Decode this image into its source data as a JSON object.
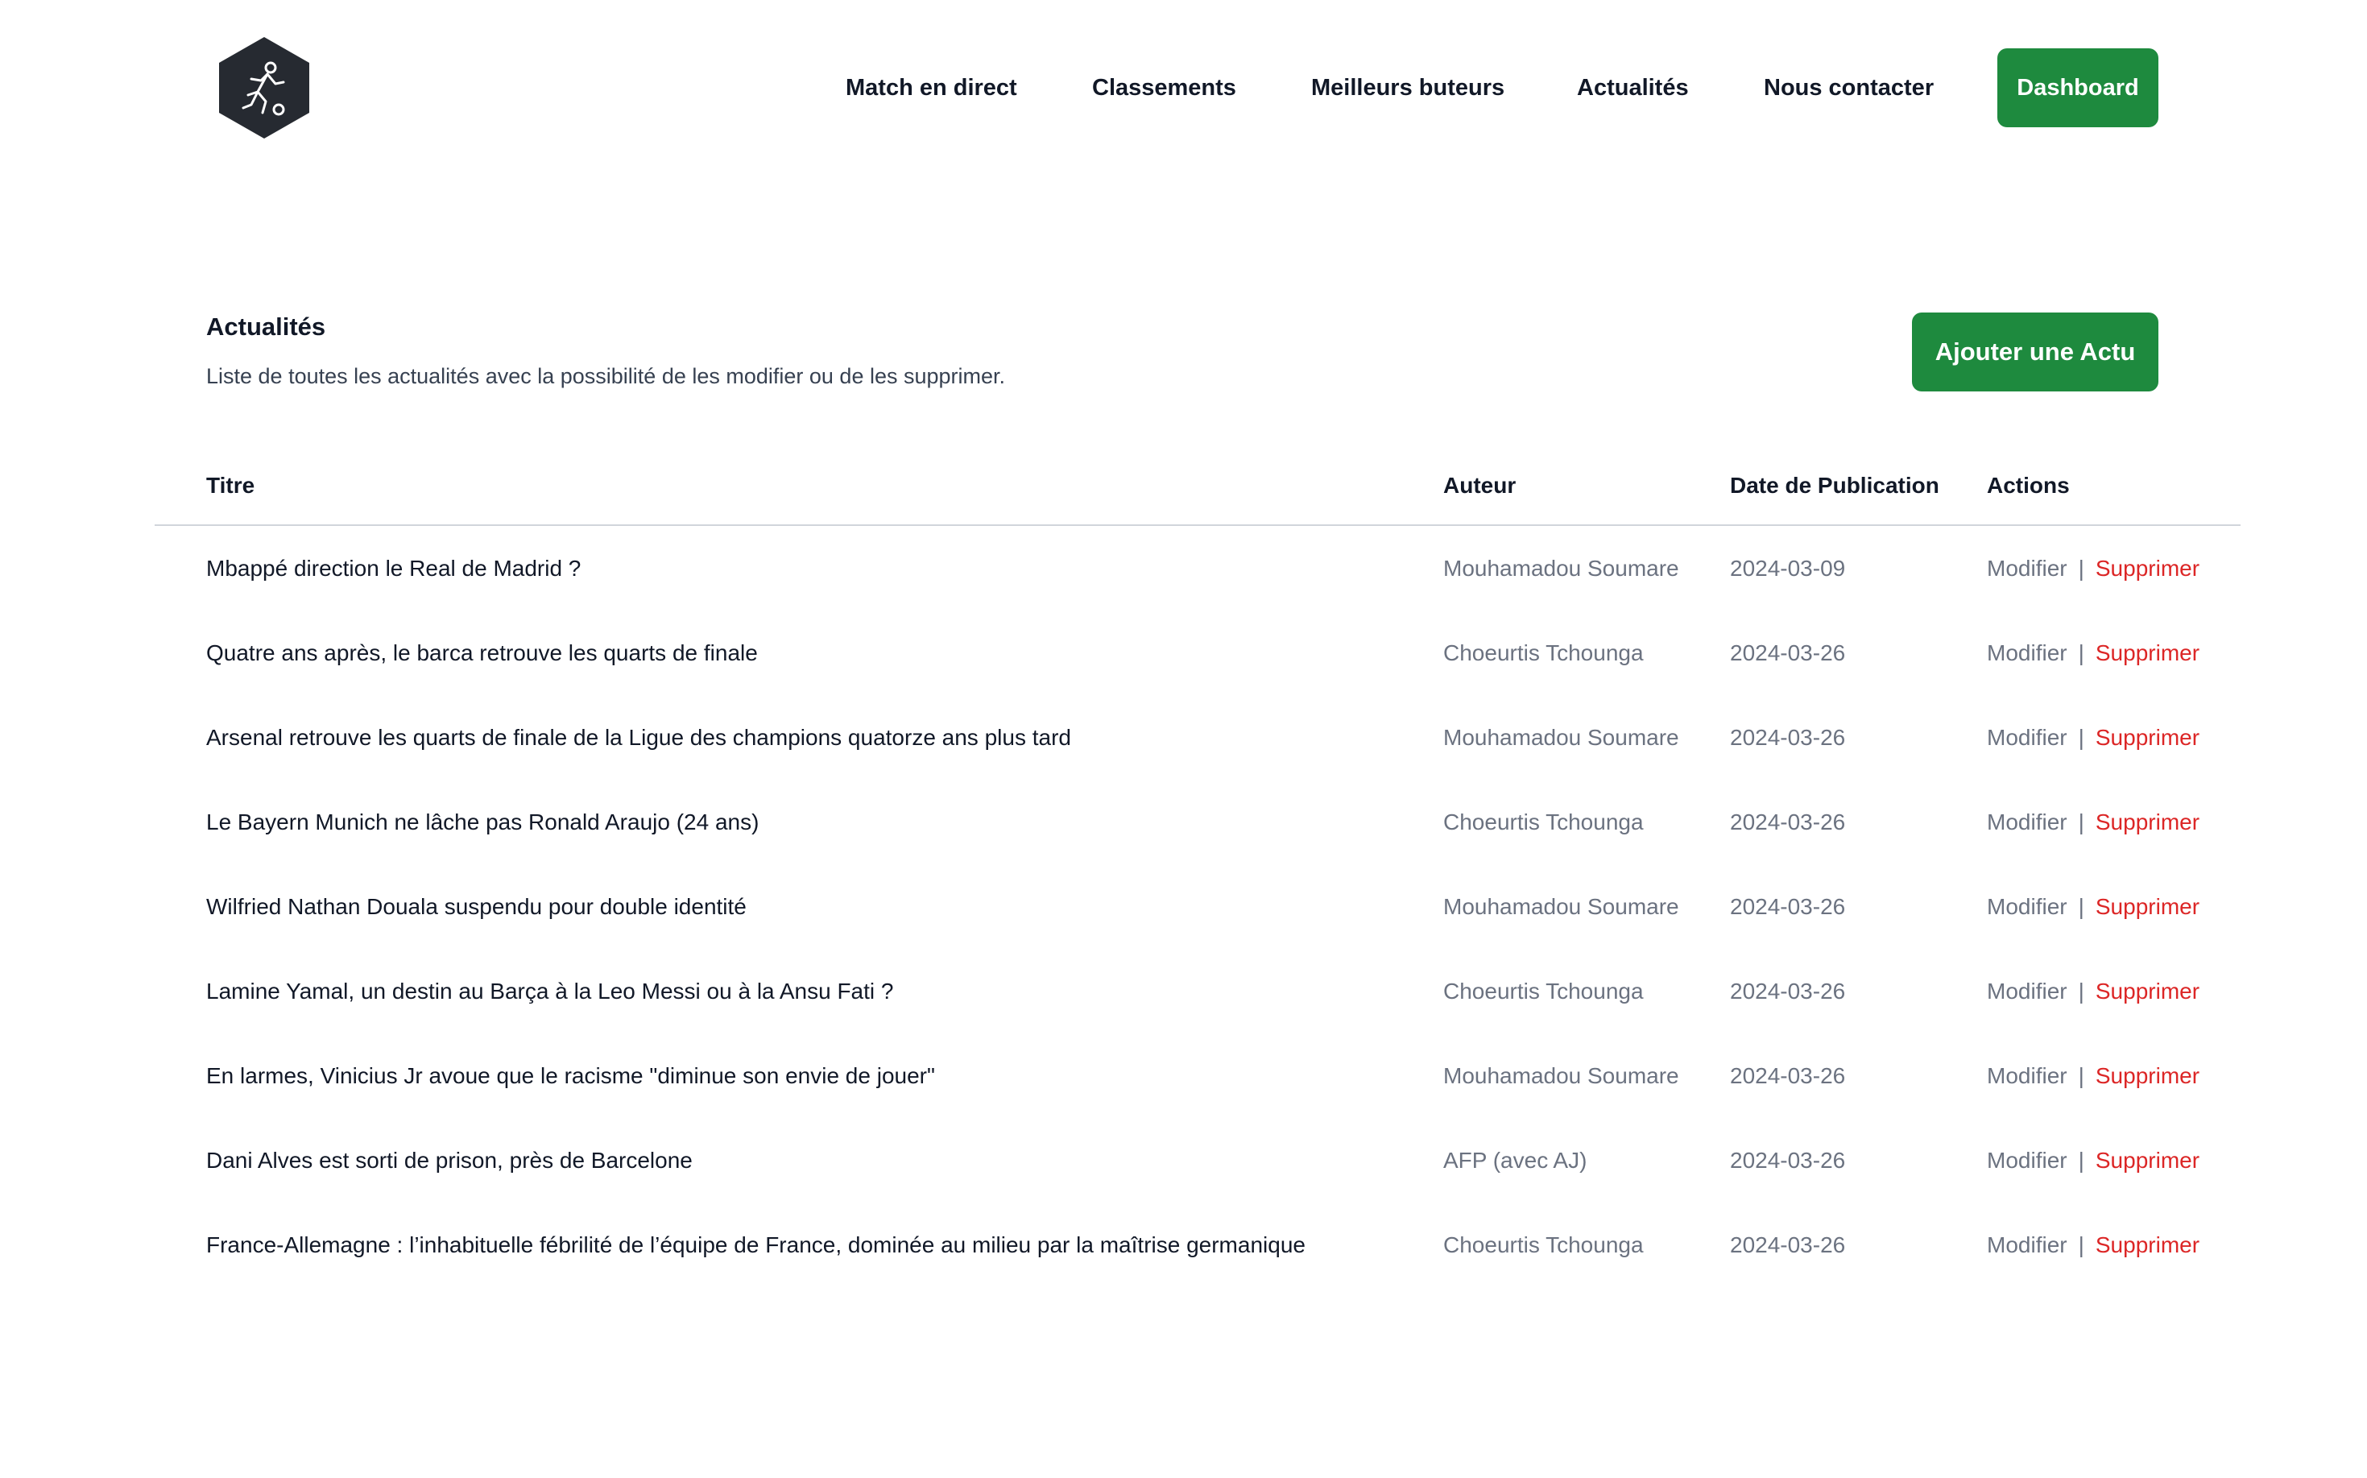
{
  "nav": {
    "links": [
      "Match en direct",
      "Classements",
      "Meilleurs buteurs",
      "Actualités",
      "Nous contacter"
    ],
    "dashboard": "Dashboard"
  },
  "brand": {
    "logo_icon": "soccer-player-icon",
    "accent": "#1e8a3e",
    "danger": "#dc2626"
  },
  "section": {
    "title": "Actualités",
    "description": "Liste de toutes les actualités avec la possibilité de les modifier ou de les supprimer.",
    "add_button": "Ajouter une Actu"
  },
  "table": {
    "headers": {
      "title": "Titre",
      "author": "Auteur",
      "date": "Date de Publication",
      "actions": "Actions"
    },
    "action_edit": "Modifier",
    "action_separator": "|",
    "action_delete": "Supprimer",
    "rows": [
      {
        "title": "Mbappé direction le Real de Madrid ?",
        "author": "Mouhamadou Soumare",
        "date": "2024-03-09"
      },
      {
        "title": "Quatre ans après, le barca retrouve les quarts de finale",
        "author": "Choeurtis Tchounga",
        "date": "2024-03-26"
      },
      {
        "title": "Arsenal retrouve les quarts de finale de la Ligue des champions quatorze ans plus tard",
        "author": "Mouhamadou Soumare",
        "date": "2024-03-26"
      },
      {
        "title": "Le Bayern Munich ne lâche pas Ronald Araujo (24 ans)",
        "author": "Choeurtis Tchounga",
        "date": "2024-03-26"
      },
      {
        "title": "Wilfried Nathan Douala suspendu pour double identité",
        "author": "Mouhamadou Soumare",
        "date": "2024-03-26"
      },
      {
        "title": "Lamine Yamal, un destin au Barça à la Leo Messi ou à la Ansu Fati ?",
        "author": "Choeurtis Tchounga",
        "date": "2024-03-26"
      },
      {
        "title": "En larmes, Vinicius Jr avoue que le racisme \"diminue son envie de jouer\"",
        "author": "Mouhamadou Soumare",
        "date": "2024-03-26"
      },
      {
        "title": "Dani Alves est sorti de prison, près de Barcelone",
        "author": "AFP (avec AJ)",
        "date": "2024-03-26"
      },
      {
        "title": "France-Allemagne : l’inhabituelle fébrilité de l’équipe de France, dominée au milieu par la maîtrise germanique",
        "author": "Choeurtis Tchounga",
        "date": "2024-03-26"
      }
    ]
  }
}
